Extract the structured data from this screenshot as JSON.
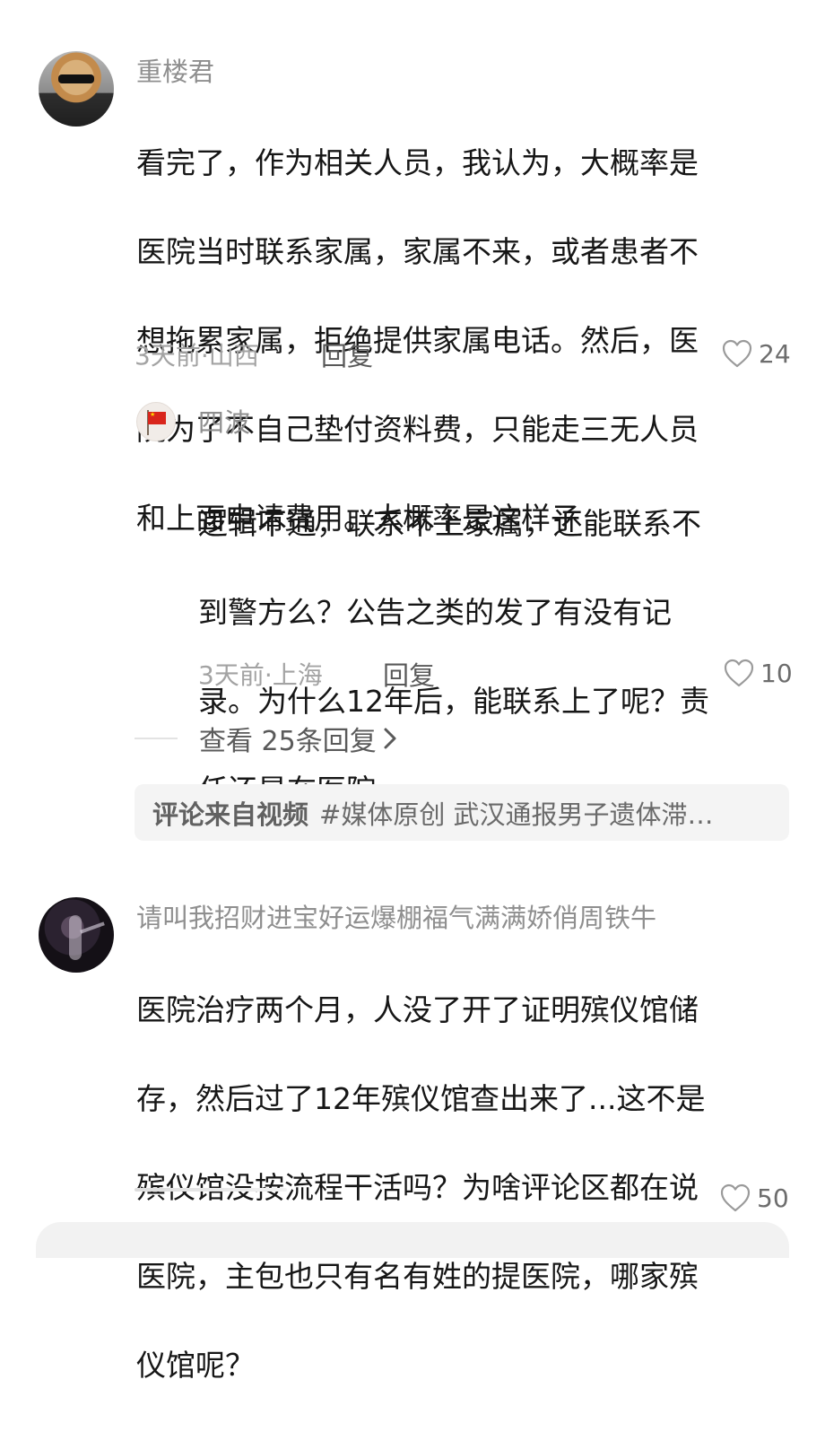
{
  "comments": [
    {
      "author": "重楼君",
      "avatar_icon": "dog-sunglasses-avatar",
      "text_lines": [
        "看完了，作为相关人员，我认为，大概率是",
        "医院当时联系家属，家属不来，或者患者不",
        "想拖累家属，拒绝提供家属电话。然后，医",
        "院为了不自己垫付资料费，只能走三无人员",
        "和上面申请费用。大概率是这样子"
      ],
      "time_location": "3天前·山西",
      "reply_label": "回复",
      "likes": "24"
    },
    {
      "author": "四波",
      "avatar_icon": "red-flag-avatar",
      "text_lines": [
        "逻辑不通，联系不上家属，还能联系不",
        "到警方么？公告之类的发了有没有记",
        "录。为什么12年后，能联系上了呢？责",
        "任还是在医院"
      ],
      "time_location": "3天前·上海",
      "reply_label": "回复",
      "likes": "10"
    },
    {
      "author": "请叫我招财进宝好运爆棚福气满满娇俏周铁牛",
      "avatar_icon": "dark-figure-avatar",
      "text_lines": [
        "医院治疗两个月，人没了开了证明殡仪馆储",
        "存，然后过了12年殡仪馆查出来了...这不是",
        "殡仪馆没按流程干活吗？为啥评论区都在说",
        "医院，主包也只有名有姓的提医院，哪家殡",
        "仪馆呢？"
      ],
      "likes": "50"
    }
  ],
  "view_more": {
    "label": "查看 25条回复",
    "icon": "chevron-right-icon"
  },
  "source": {
    "lead": "评论来自视频",
    "topic": "#媒体原创 武汉通报男子遗体滞…"
  },
  "colors": {
    "text_primary": "#161616",
    "text_name": "#8f8f8f",
    "text_meta": "#a3a3a3",
    "bar_bg": "#f4f4f4"
  }
}
